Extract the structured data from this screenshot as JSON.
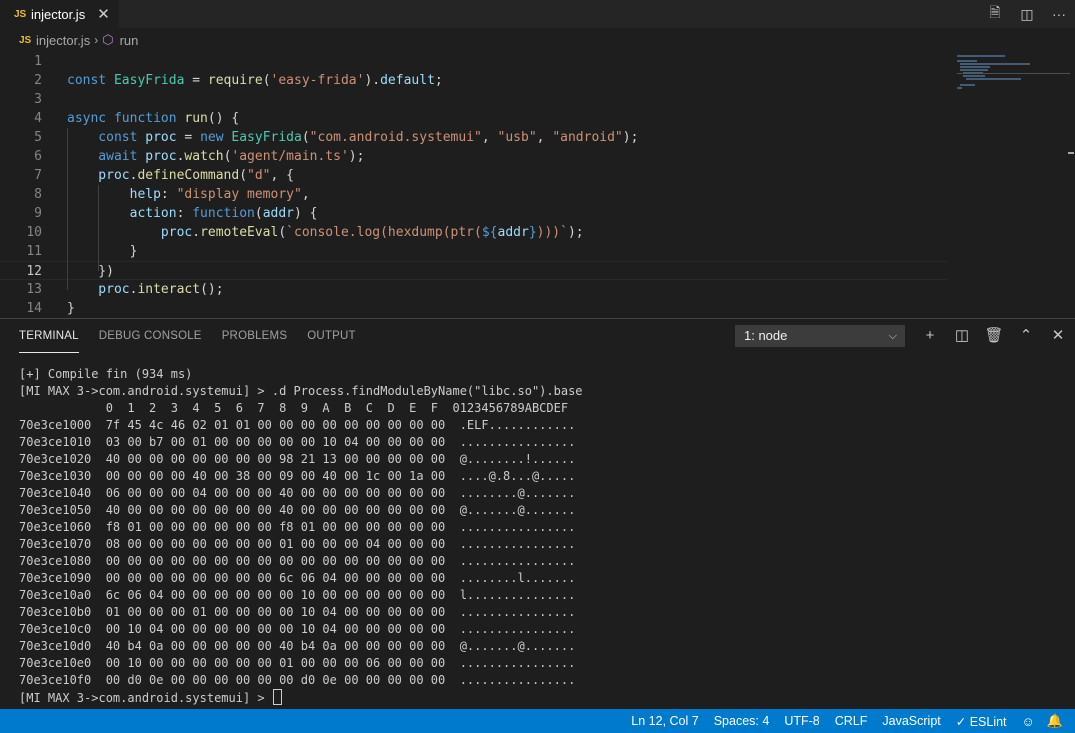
{
  "tab": {
    "badge": "JS",
    "title": "injector.js",
    "close": "✕"
  },
  "top_actions": {
    "open_preview": "🗎",
    "split_editor": "◫",
    "more": "···"
  },
  "breadcrumb": {
    "badge": "JS",
    "file": "injector.js",
    "sep": "›",
    "symbol_icon": "⬡",
    "symbol": "run"
  },
  "editor": {
    "line_numbers": [
      "1",
      "2",
      "3",
      "4",
      "5",
      "6",
      "7",
      "8",
      "9",
      "10",
      "11",
      "12",
      "13",
      "14"
    ],
    "lines": [
      [],
      [
        [
          "kw",
          "const "
        ],
        [
          "cls",
          "EasyFrida"
        ],
        [
          "pl",
          " = "
        ],
        [
          "fn",
          "require"
        ],
        [
          "pl",
          "("
        ],
        [
          "str",
          "'easy-frida'"
        ],
        [
          "pl",
          ")."
        ],
        [
          "var",
          "default"
        ],
        [
          "pl",
          ";"
        ]
      ],
      [],
      [
        [
          "kw",
          "async function "
        ],
        [
          "fn",
          "run"
        ],
        [
          "pl",
          "() {"
        ]
      ],
      [
        [
          "kw",
          "    const "
        ],
        [
          "var",
          "proc"
        ],
        [
          "pl",
          " = "
        ],
        [
          "kw",
          "new "
        ],
        [
          "cls",
          "EasyFrida"
        ],
        [
          "pl",
          "("
        ],
        [
          "str",
          "\"com.android.systemui\""
        ],
        [
          "pl",
          ", "
        ],
        [
          "str",
          "\"usb\""
        ],
        [
          "pl",
          ", "
        ],
        [
          "str",
          "\"android\""
        ],
        [
          "pl",
          ");"
        ]
      ],
      [
        [
          "kw",
          "    await "
        ],
        [
          "var",
          "proc"
        ],
        [
          "pl",
          "."
        ],
        [
          "fn",
          "watch"
        ],
        [
          "pl",
          "("
        ],
        [
          "str",
          "'agent/main.ts'"
        ],
        [
          "pl",
          ");"
        ]
      ],
      [
        [
          "var",
          "    proc"
        ],
        [
          "pl",
          "."
        ],
        [
          "fn",
          "defineCommand"
        ],
        [
          "pl",
          "("
        ],
        [
          "str",
          "\"d\""
        ],
        [
          "pl",
          ", {"
        ]
      ],
      [
        [
          "var",
          "        help"
        ],
        [
          "pl",
          ": "
        ],
        [
          "str",
          "\"display memory\""
        ],
        [
          "pl",
          ","
        ]
      ],
      [
        [
          "var",
          "        action"
        ],
        [
          "pl",
          ": "
        ],
        [
          "kw",
          "function"
        ],
        [
          "pl",
          "("
        ],
        [
          "var",
          "addr"
        ],
        [
          "pl",
          ") {"
        ]
      ],
      [
        [
          "var",
          "            proc"
        ],
        [
          "pl",
          "."
        ],
        [
          "fn",
          "remoteEval"
        ],
        [
          "pl",
          "("
        ],
        [
          "str",
          "`console.log(hexdump(ptr("
        ],
        [
          "kw",
          "${"
        ],
        [
          "var",
          "addr"
        ],
        [
          "kw",
          "}"
        ],
        [
          "str",
          ")))`"
        ],
        [
          "pl",
          ");"
        ]
      ],
      [
        [
          "pl",
          "        }"
        ]
      ],
      [
        [
          "pl",
          "    })"
        ]
      ],
      [
        [
          "var",
          "    proc"
        ],
        [
          "pl",
          "."
        ],
        [
          "fn",
          "interact"
        ],
        [
          "pl",
          "();"
        ]
      ],
      [
        [
          "pl",
          "}"
        ]
      ]
    ]
  },
  "panel": {
    "tabs": [
      "TERMINAL",
      "DEBUG CONSOLE",
      "PROBLEMS",
      "OUTPUT"
    ],
    "terminal_select": "1: node",
    "actions": {
      "new": "+",
      "split": "◫",
      "kill": "🗑",
      "maximize": "⌃",
      "close": "✕"
    }
  },
  "terminal": {
    "lines": [
      "[+] Compile fin (934 ms)",
      "[MI MAX 3->com.android.systemui] > .d Process.findModuleByName(\"libc.so\").base",
      "            0  1  2  3  4  5  6  7  8  9  A  B  C  D  E  F  0123456789ABCDEF",
      "70e3ce1000  7f 45 4c 46 02 01 01 00 00 00 00 00 00 00 00 00  .ELF............",
      "70e3ce1010  03 00 b7 00 01 00 00 00 00 00 10 04 00 00 00 00  ................",
      "70e3ce1020  40 00 00 00 00 00 00 00 98 21 13 00 00 00 00 00  @........!......",
      "70e3ce1030  00 00 00 00 40 00 38 00 09 00 40 00 1c 00 1a 00  ....@.8...@.....",
      "70e3ce1040  06 00 00 00 04 00 00 00 40 00 00 00 00 00 00 00  ........@.......",
      "70e3ce1050  40 00 00 00 00 00 00 00 40 00 00 00 00 00 00 00  @.......@.......",
      "70e3ce1060  f8 01 00 00 00 00 00 00 f8 01 00 00 00 00 00 00  ................",
      "70e3ce1070  08 00 00 00 00 00 00 00 01 00 00 00 04 00 00 00  ................",
      "70e3ce1080  00 00 00 00 00 00 00 00 00 00 00 00 00 00 00 00  ................",
      "70e3ce1090  00 00 00 00 00 00 00 00 6c 06 04 00 00 00 00 00  ........l.......",
      "70e3ce10a0  6c 06 04 00 00 00 00 00 00 10 00 00 00 00 00 00  l...............",
      "70e3ce10b0  01 00 00 00 01 00 00 00 00 10 04 00 00 00 00 00  ................",
      "70e3ce10c0  00 10 04 00 00 00 00 00 00 10 04 00 00 00 00 00  ................",
      "70e3ce10d0  40 b4 0a 00 00 00 00 00 40 b4 0a 00 00 00 00 00  @.......@.......",
      "70e3ce10e0  00 10 00 00 00 00 00 00 01 00 00 00 06 00 00 00  ................",
      "70e3ce10f0  00 d0 0e 00 00 00 00 00 00 d0 0e 00 00 00 00 00  ................"
    ],
    "prompt": "[MI MAX 3->com.android.systemui] > "
  },
  "status": {
    "position": "Ln 12, Col 7",
    "indent": "Spaces: 4",
    "encoding": "UTF-8",
    "eol": "CRLF",
    "language": "JavaScript",
    "eslint": "✓ ESLint",
    "feedback_icon": "☺",
    "bell_icon": "🔔"
  }
}
